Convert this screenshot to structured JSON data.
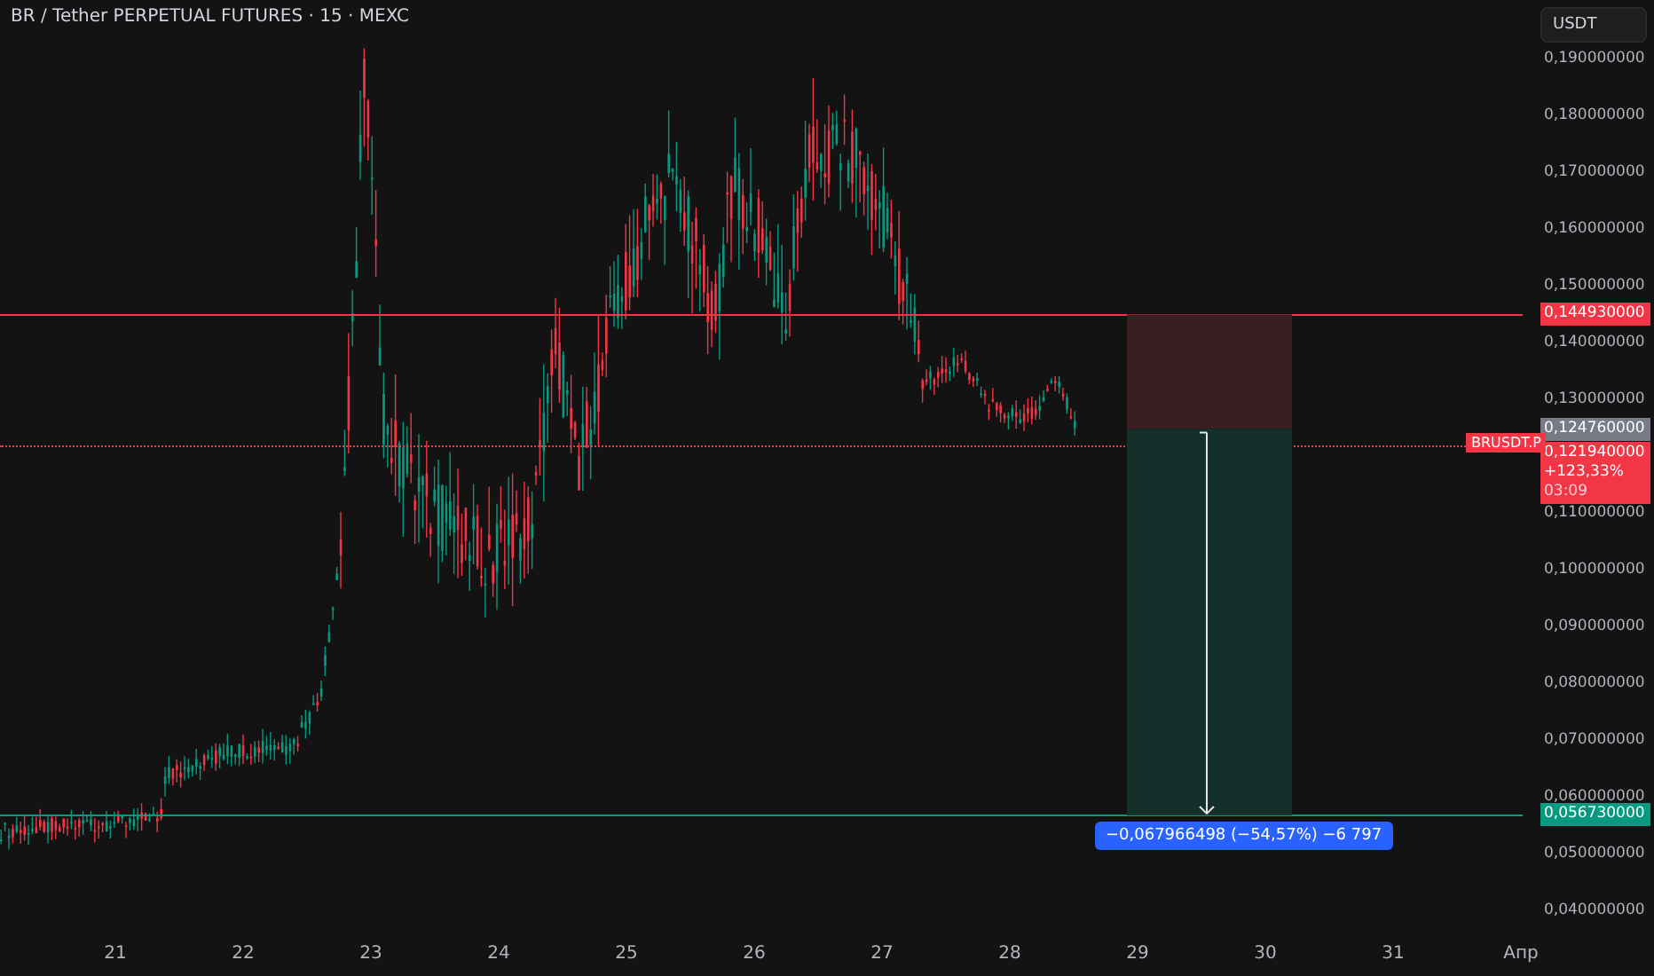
{
  "chart_title": "BR / Tether PERPETUAL FUTURES · 15 · MEXC",
  "currency_button": "USDT",
  "price_ticks": [
    {
      "label": "0,190000000"
    },
    {
      "label": "0,180000000"
    },
    {
      "label": "0,170000000"
    },
    {
      "label": "0,160000000"
    },
    {
      "label": "0,150000000"
    },
    {
      "label": "0,140000000"
    },
    {
      "label": "0,130000000"
    },
    {
      "label": "0,110000000"
    },
    {
      "label": "0,100000000"
    },
    {
      "label": "0,090000000"
    },
    {
      "label": "0,080000000"
    },
    {
      "label": "0,070000000"
    },
    {
      "label": "0,060000000"
    },
    {
      "label": "0,050000000"
    },
    {
      "label": "0,040000000"
    }
  ],
  "time_ticks": [
    "21",
    "22",
    "23",
    "24",
    "25",
    "26",
    "27",
    "28",
    "29",
    "30",
    "31",
    "Апр"
  ],
  "price_lines": [
    {
      "kind": "stop",
      "label": "0,144930000",
      "color": "#f23645"
    },
    {
      "kind": "target",
      "label": "0,056730000",
      "color": "#089981"
    }
  ],
  "entry_label": "0,124760000",
  "last_price": {
    "symbol": "BRUSDT.P",
    "price": "0,121940000",
    "change": "+123,33%",
    "countdown": "03:09"
  },
  "measure_label": "−0,067966498 (−54,57%) −6 797"
}
